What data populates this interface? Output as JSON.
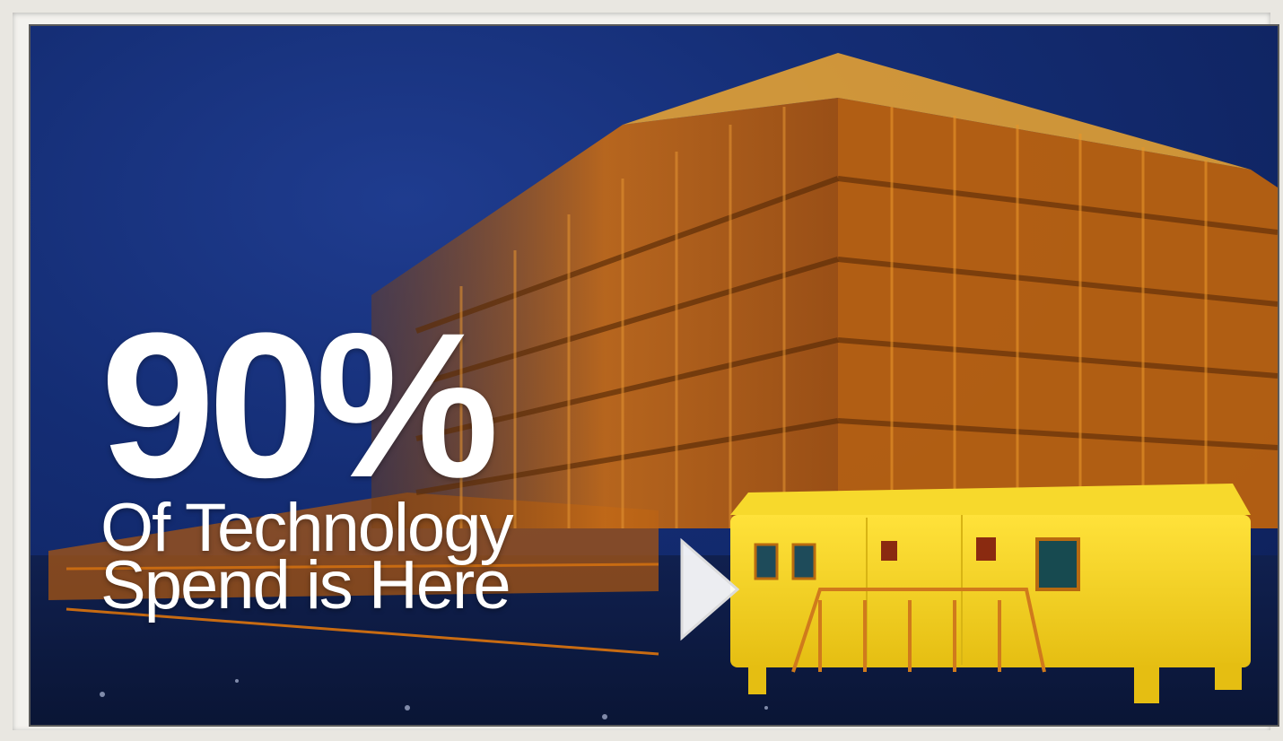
{
  "headline": {
    "stat": "90%",
    "line1": "Of Technology",
    "line2": "Spend is Here"
  },
  "video": {
    "play_icon": "play-icon"
  },
  "colors": {
    "background_sky": "#142d74",
    "building": "#d07a1c",
    "trailer": "#f2d21e",
    "text": "#ffffff"
  }
}
